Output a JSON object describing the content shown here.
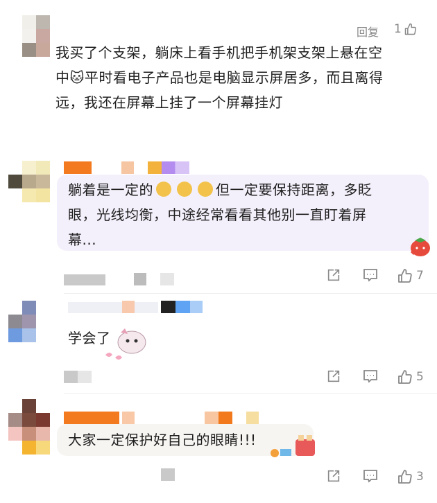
{
  "comment1": {
    "reply_label": "回复",
    "like_count": "1",
    "lines": [
      "我买了个支架，躺床上看手机把手机架支架上悬在空",
      "中🐱平时看电子产品也是电脑显示屏居多，而且离得",
      "远，我还在屏幕上挂了一个屏幕挂灯"
    ]
  },
  "comment2": {
    "text_part1": "躺着是一定的",
    "text_part2": "但一定要保持距离，多眨",
    "line2": "眼，光线均衡，中途经常看看其他别一直盯着屏",
    "line3": "幕...",
    "like_count": "7"
  },
  "comment3": {
    "text": "学会了",
    "like_count": "5"
  },
  "comment4": {
    "text": "大家一定保护好自己的眼睛!!!",
    "like_count": "3"
  },
  "colors": {
    "bubble_purple": "#f4f0fb",
    "bubble_white": "#f7f5f2",
    "icon_gray": "#8a8a8a",
    "name_orange": "#f47a20"
  }
}
